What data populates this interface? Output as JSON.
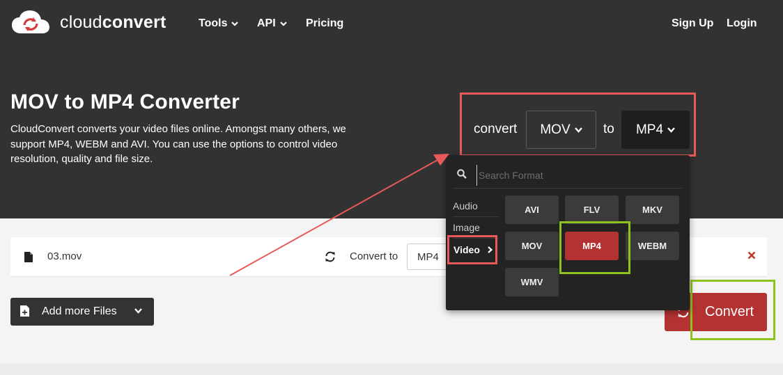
{
  "brand": {
    "name_light": "cloud",
    "name_bold": "convert"
  },
  "nav": {
    "tools": "Tools",
    "api": "API",
    "pricing": "Pricing",
    "sign_up": "Sign Up",
    "login": "Login"
  },
  "hero": {
    "title": "MOV to MP4 Converter",
    "description": "CloudConvert converts your video files online. Amongst many others, we support MP4, WEBM and AVI. You can use the options to control video resolution, quality and file size."
  },
  "converter": {
    "convert_word": "convert",
    "to_word": "to",
    "from_format": "MOV",
    "to_format": "MP4"
  },
  "dropdown": {
    "search_placeholder": "Search Format",
    "categories": [
      "Audio",
      "Image",
      "Video"
    ],
    "selected_category": "Video",
    "formats": [
      "AVI",
      "FLV",
      "MKV",
      "MOV",
      "MP4",
      "WEBM",
      "WMV"
    ],
    "selected_format": "MP4"
  },
  "file": {
    "name": "03.mov",
    "convert_to_label": "Convert to",
    "target_format": "MP4"
  },
  "actions": {
    "add_more_files": "Add more Files",
    "convert": "Convert"
  },
  "colors": {
    "hero_bg": "#323232",
    "accent_red": "#b53232",
    "highlight_red": "#e85a5a",
    "highlight_green": "#8ec21f"
  }
}
